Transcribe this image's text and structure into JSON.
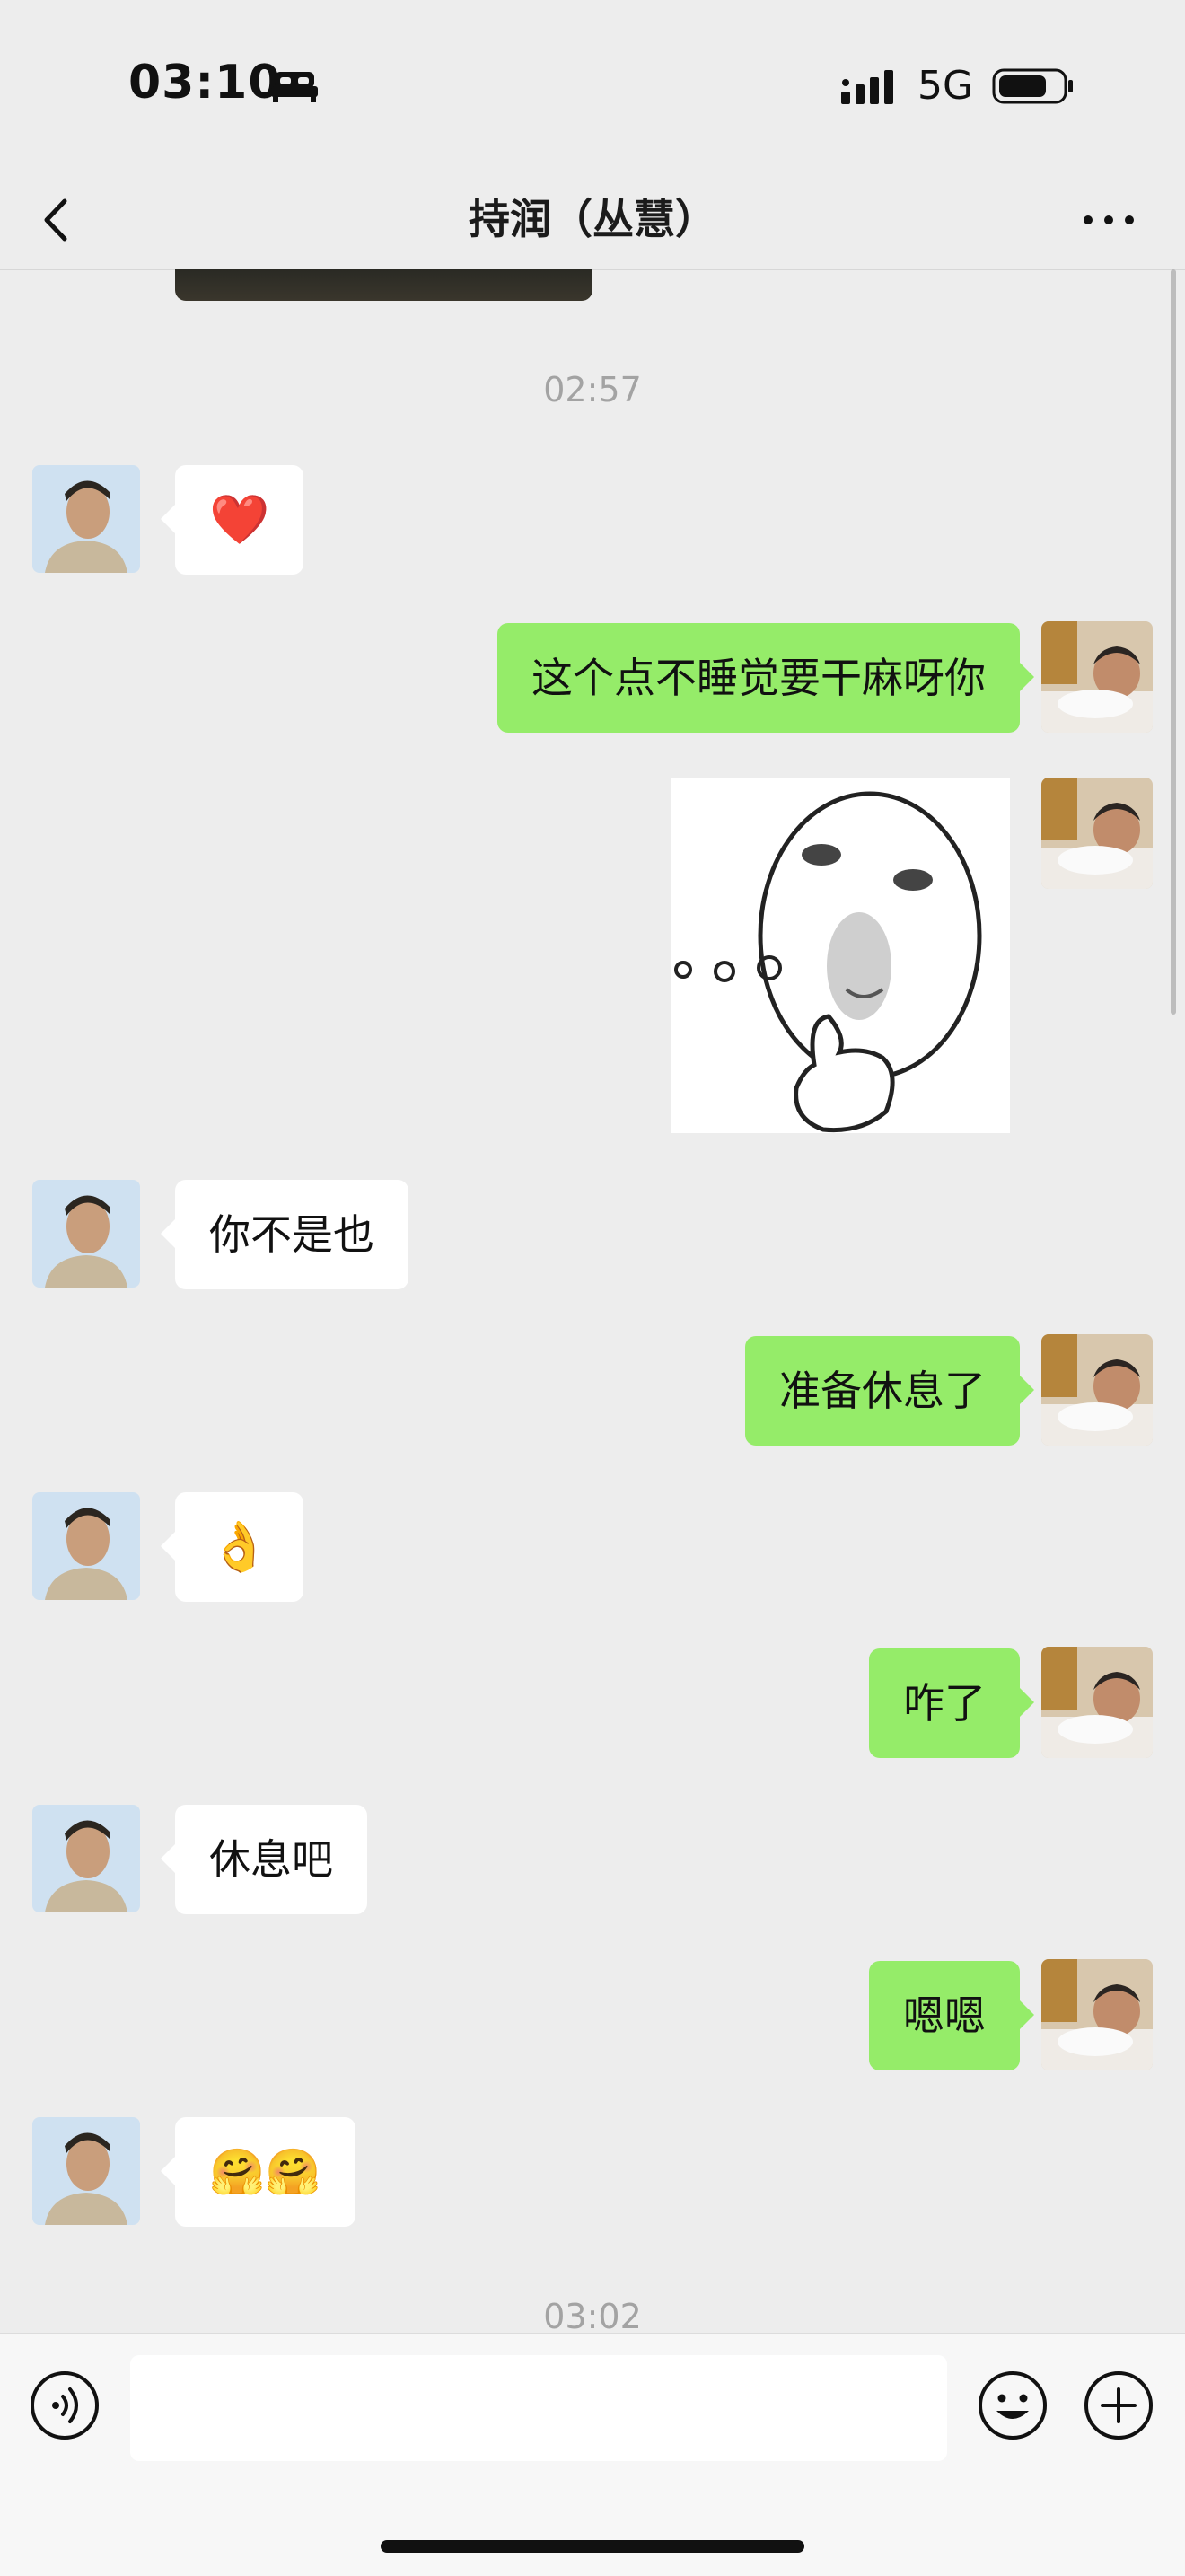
{
  "status_bar": {
    "time": "03:10",
    "network": "5G"
  },
  "nav": {
    "title": "持润（丛慧）",
    "back_icon": "chevron-left-icon",
    "more_icon": "more-dots-icon"
  },
  "chat": {
    "timestamps": [
      "02:57",
      "03:02"
    ],
    "messages": [
      {
        "side": "in",
        "type": "emoji",
        "content": "❤️"
      },
      {
        "side": "out",
        "type": "text",
        "content": "这个点不睡觉要干麻呀你"
      },
      {
        "side": "out",
        "type": "sticker",
        "content": "thinking-face-sticker"
      },
      {
        "side": "in",
        "type": "text",
        "content": "你不是也"
      },
      {
        "side": "out",
        "type": "text",
        "content": "准备休息了"
      },
      {
        "side": "in",
        "type": "emoji",
        "content": "👌"
      },
      {
        "side": "out",
        "type": "text",
        "content": "咋了"
      },
      {
        "side": "in",
        "type": "text",
        "content": "休息吧"
      },
      {
        "side": "out",
        "type": "text",
        "content": "嗯嗯"
      },
      {
        "side": "in",
        "type": "emoji",
        "content": "🤗🤗"
      }
    ]
  },
  "input_bar": {
    "placeholder": "",
    "voice_icon": "voice-icon",
    "emoji_icon": "emoji-icon",
    "plus_icon": "plus-icon"
  },
  "colors": {
    "background": "#ededed",
    "outgoing_bubble": "#95ec69",
    "incoming_bubble": "#ffffff"
  }
}
